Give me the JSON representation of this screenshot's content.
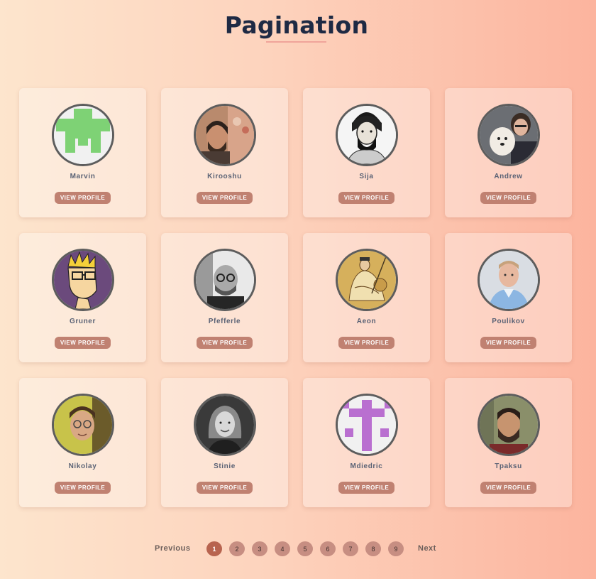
{
  "page": {
    "title": "Pagination"
  },
  "cards": [
    {
      "name": "Marvin",
      "button": "VIEW PROFILE",
      "avatar": "identicon-green"
    },
    {
      "name": "Kirooshu",
      "button": "VIEW PROFILE",
      "avatar": "photo-man-beard"
    },
    {
      "name": "Sija",
      "button": "VIEW PROFILE",
      "avatar": "sketch-bearded-man"
    },
    {
      "name": "Andrew",
      "button": "VIEW PROFILE",
      "avatar": "photo-woman-dog"
    },
    {
      "name": "Gruner",
      "button": "VIEW PROFILE",
      "avatar": "cartoon-man-glasses"
    },
    {
      "name": "Pfefferle",
      "button": "VIEW PROFILE",
      "avatar": "photo-bald-glasses"
    },
    {
      "name": "Aeon",
      "button": "VIEW PROFILE",
      "avatar": "painting-seated-figure"
    },
    {
      "name": "Poulikov",
      "button": "VIEW PROFILE",
      "avatar": "photo-man-blue-shirt"
    },
    {
      "name": "Nikolay",
      "button": "VIEW PROFILE",
      "avatar": "photo-man-glasses-yellow"
    },
    {
      "name": "Stinie",
      "button": "VIEW PROFILE",
      "avatar": "photo-woman-bw"
    },
    {
      "name": "Mdiedric",
      "button": "VIEW PROFILE",
      "avatar": "identicon-purple"
    },
    {
      "name": "Tpaksu",
      "button": "VIEW PROFILE",
      "avatar": "photo-man-beard-dark"
    }
  ],
  "pagination": {
    "previous": "Previous",
    "next": "Next",
    "pages": [
      "1",
      "2",
      "3",
      "4",
      "5",
      "6",
      "7",
      "8",
      "9"
    ],
    "active": "1"
  },
  "colors": {
    "button": "#c08171",
    "active_page": "#b8644f",
    "page": "#c78e82",
    "title": "#1e2a44"
  }
}
